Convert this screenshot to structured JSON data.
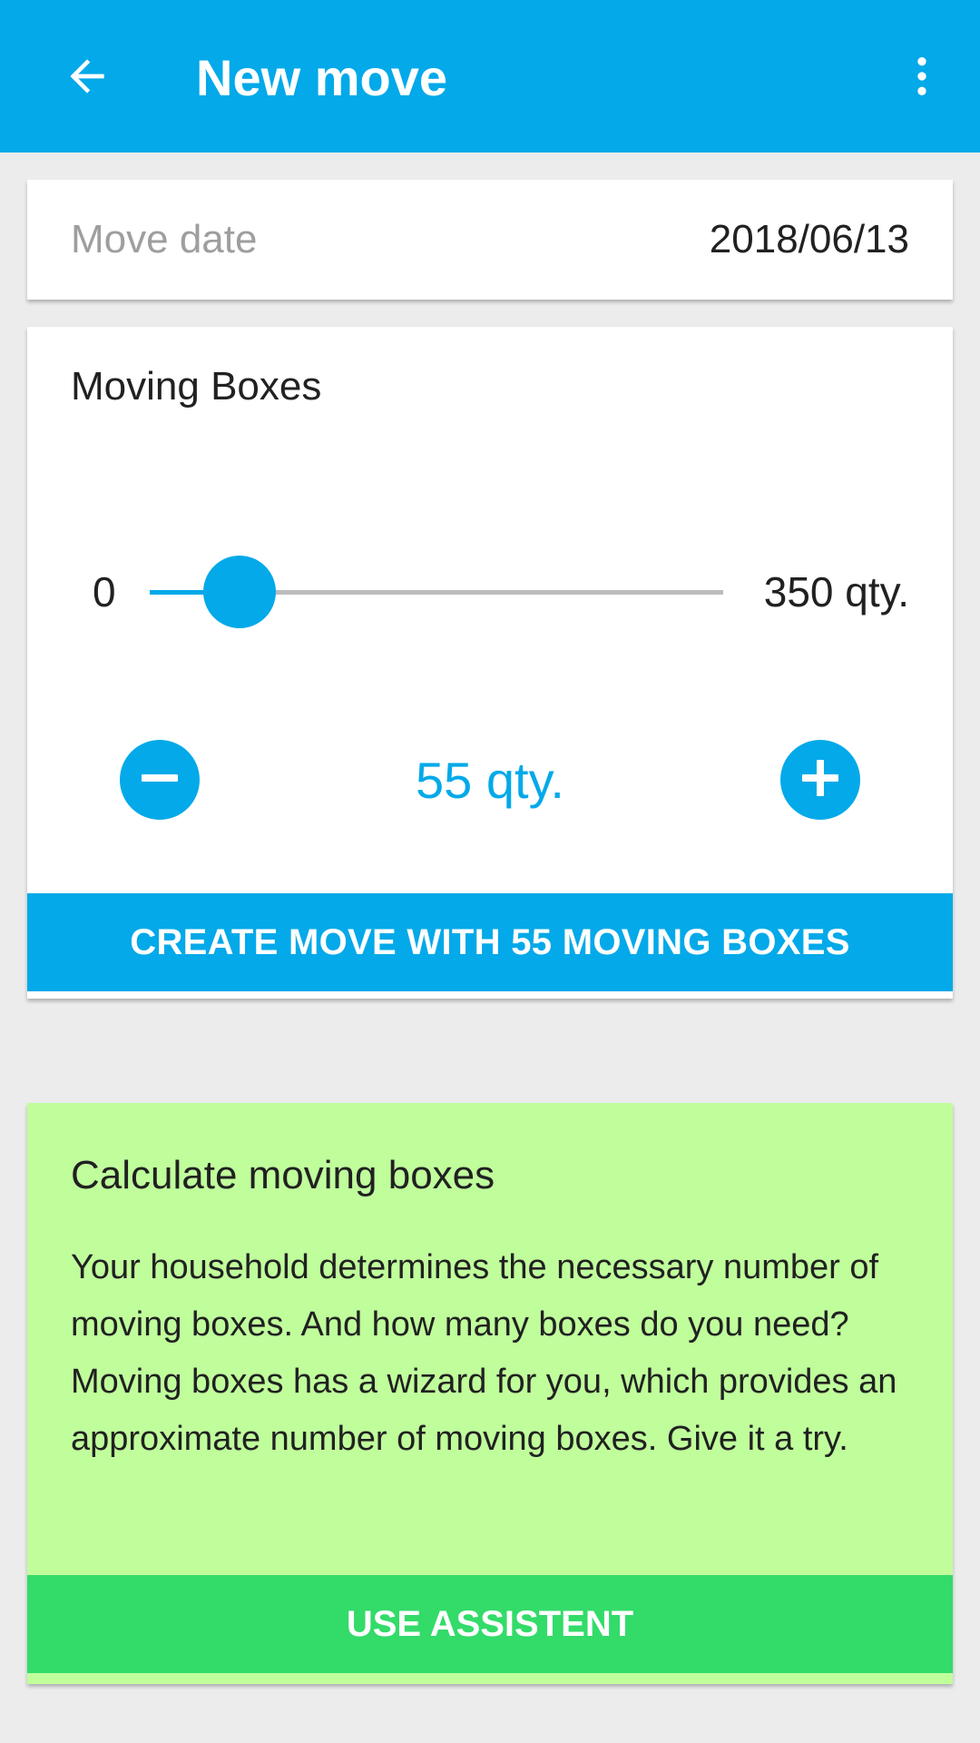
{
  "appbar": {
    "title": "New move",
    "back_icon": "arrow-back-icon",
    "menu_icon": "more-vert-icon",
    "color": "#03a9e9"
  },
  "move_date": {
    "label": "Move date",
    "value": "2018/06/13"
  },
  "moving_boxes": {
    "title": "Moving Boxes",
    "slider_min_label": "0",
    "slider_max_label": "350 qty.",
    "slider_min": 0,
    "slider_max": 350,
    "slider_value": 55,
    "quantity_label": "55 qty.",
    "decrease_icon": "minus-circle-icon",
    "increase_icon": "plus-circle-icon",
    "create_button_label": "CREATE MOVE WITH 55 MOVING BOXES"
  },
  "calculator": {
    "title": "Calculate moving boxes",
    "description": "Your household determines the necessary number of moving boxes. And how many boxes do you need? Moving boxes has a wizard for you, which provides an approximate number of moving boxes. Give it a try.",
    "button_label": "USE ASSISTENT",
    "background_color": "#c0fe9c",
    "button_color": "#33db69"
  }
}
